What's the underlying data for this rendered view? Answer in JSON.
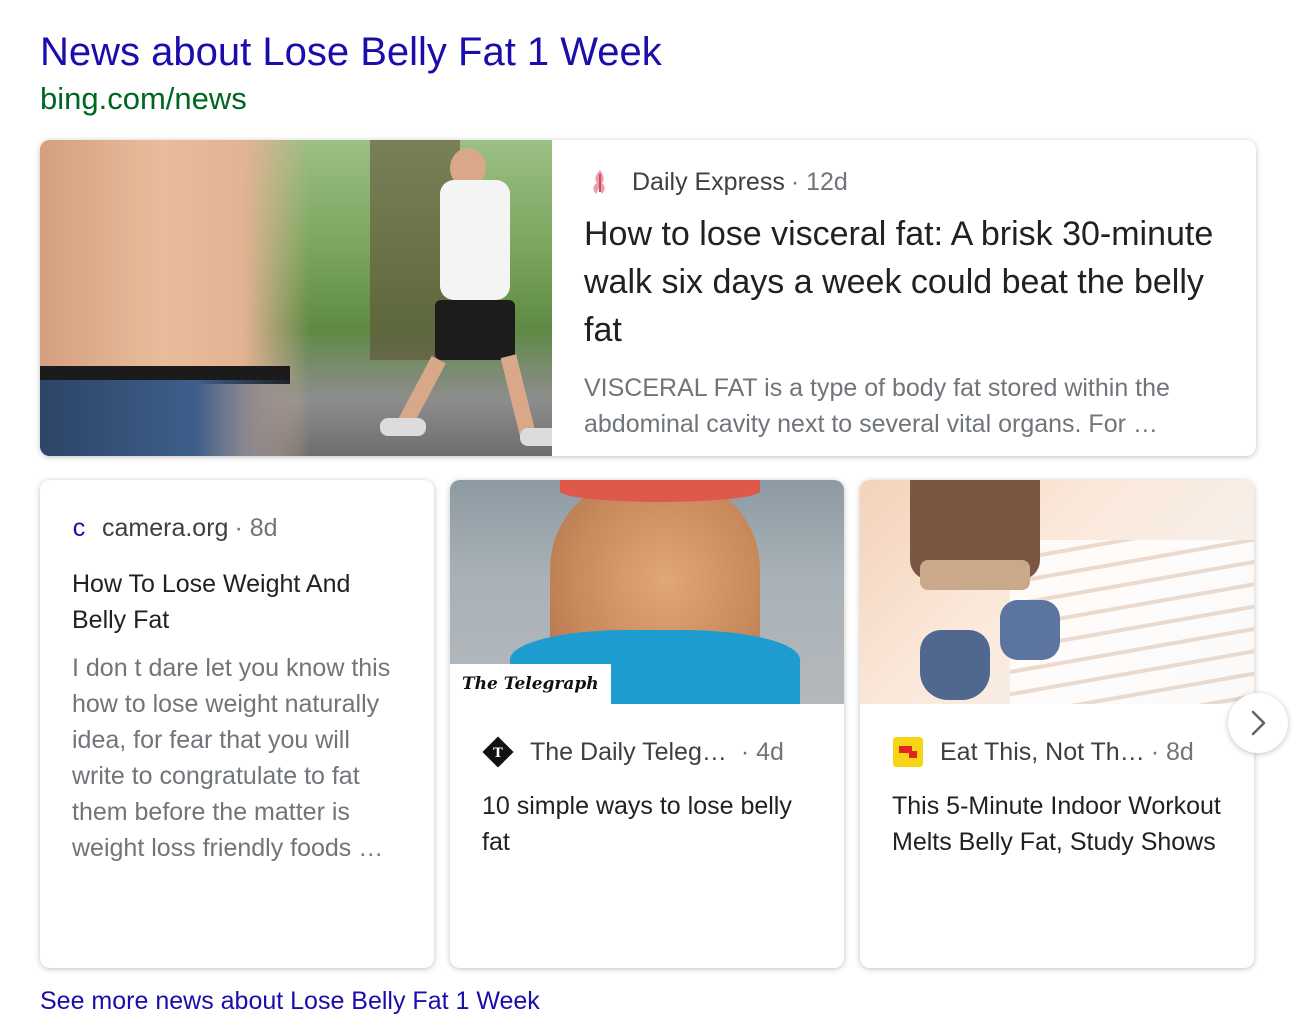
{
  "header": {
    "title": "News about Lose Belly Fat 1 Week",
    "url": "bing.com/news"
  },
  "featured": {
    "publisher": "Daily Express",
    "age": "· 12d",
    "title": "How to lose visceral fat: A brisk 30-minute walk six days a week could beat the belly fat",
    "snippet": "VISCERAL FAT is a type of body fat stored within the abdominal cavity next to several vital organs. For …",
    "icon": "daily-express-logo"
  },
  "cards": [
    {
      "publisher": "camera.org",
      "age": "· 8d",
      "icon_letter": "c",
      "title": "How To Lose Weight And Belly Fat",
      "snippet": "I don t dare let you know this how to lose weight naturally idea, for fear that you will write to congratulate to fat them before the matter is weight loss friendly foods …"
    },
    {
      "publisher": "The Daily Teleg…",
      "age": "· 4d",
      "image_badge": "The Telegraph",
      "icon": "telegraph-logo",
      "title": "10 simple ways to lose belly fat"
    },
    {
      "publisher": "Eat This, Not Th…",
      "age": "· 8d",
      "icon": "eat-this-logo",
      "title": "This 5-Minute Indoor Workout Melts Belly Fat, Study Shows"
    }
  ],
  "see_more": "See more news about Lose Belly Fat 1 Week",
  "colors": {
    "link": "#1a0dab",
    "url_green": "#006621",
    "snippet_gray": "#70757a"
  }
}
